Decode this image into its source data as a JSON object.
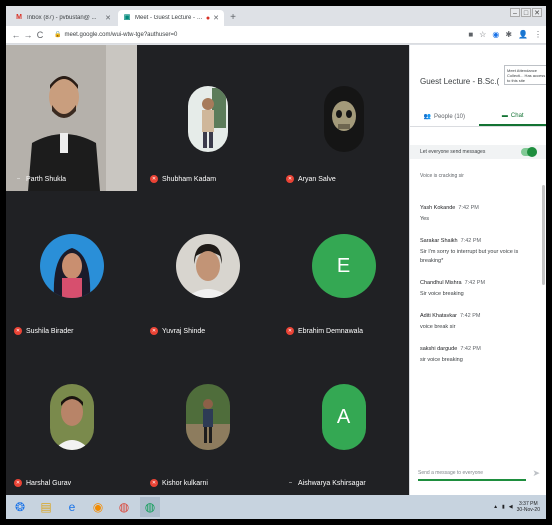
{
  "browser": {
    "tabs": [
      {
        "title": "Inbox (87) - pvbustan@ ...",
        "favicon": "gmail-icon",
        "active": false
      },
      {
        "title": "Meet - Guest Lecture - B.Sc...",
        "favicon": "meet-icon",
        "active": true,
        "recording": true
      }
    ],
    "url": "meet.google.com/wui-wtw-tge?authuser=0",
    "new_tab_glyph": "+"
  },
  "participants": [
    {
      "name": "Parth Shukla",
      "type": "video",
      "mic": "on"
    },
    {
      "name": "Shubham Kadam",
      "type": "photo",
      "mic": "off"
    },
    {
      "name": "Aryan Salve",
      "type": "photo",
      "mic": "off"
    },
    {
      "name": "Sushila Birader",
      "type": "photo",
      "mic": "off"
    },
    {
      "name": "Yuvraj Shinde",
      "type": "photo",
      "mic": "off"
    },
    {
      "name": "Ebrahim Demnawala",
      "type": "letter",
      "letter": "E",
      "mic": "off"
    },
    {
      "name": "Harshal Gurav",
      "type": "photo",
      "mic": "off"
    },
    {
      "name": "Kishor kulkarni",
      "type": "photo",
      "mic": "off"
    },
    {
      "name": "Aishwarya Kshirsagar",
      "type": "letter",
      "letter": "A",
      "mic": "on"
    }
  ],
  "panel": {
    "title": "Guest Lecture - B.Sc.(",
    "tooltip": "Meet Attendance Collecti... Has access to this site",
    "tabs": {
      "people": "People (10)",
      "chat": "Chat"
    },
    "toggle_label": "Let everyone send messages",
    "notice": "Voice is cracking sir",
    "messages": [
      {
        "sender": "Yash Kokande",
        "time": "7:42 PM",
        "text": "Yes"
      },
      {
        "sender": "Sarakar Shaikh",
        "time": "7:42 PM",
        "text": "Sir I'm sorry to interrupt but your voice is breaking*"
      },
      {
        "sender": "Chandhul Mishra",
        "time": "7:42 PM",
        "text": "Sir voice breaking"
      },
      {
        "sender": "Aditi Khatavkar",
        "time": "7:42 PM",
        "text": "voice break sir"
      },
      {
        "sender": "sakshi dargude",
        "time": "7:42 PM",
        "text": "sir voice breaking"
      }
    ],
    "compose_placeholder": "Send a message to everyone"
  },
  "taskbar": {
    "time": "3:37 PM",
    "date": "30-Nov-20"
  }
}
